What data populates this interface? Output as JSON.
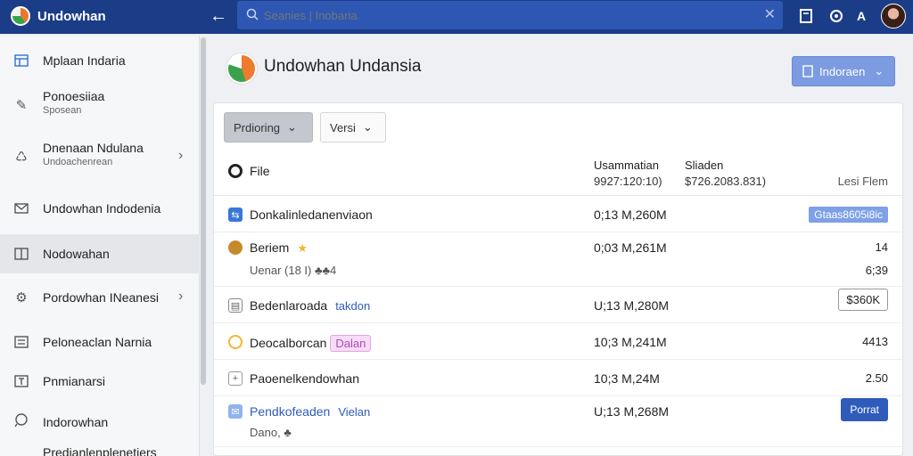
{
  "app": {
    "title": "Undowhan"
  },
  "search": {
    "placeholder": "Seanies | Inobaria"
  },
  "sidebar": {
    "items": [
      {
        "label": "Mplaan Indaria",
        "sub": ""
      },
      {
        "label": "Ponoesiiaa",
        "sub": "Sposean"
      },
      {
        "label": "Dnenaan Ndulana",
        "sub": "Undoachenrean"
      },
      {
        "label": "Undowhan Indodenia",
        "sub": ""
      },
      {
        "label": "Nodowahan",
        "sub": ""
      },
      {
        "label": "Pordowhan INeanesi",
        "sub": ""
      },
      {
        "label": "Peloneaclan Narnia",
        "sub": ""
      },
      {
        "label": "Pnmianarsi",
        "sub": ""
      },
      {
        "label": "Indorowhan",
        "sub": ""
      },
      {
        "label": "Predianlenplenetiers",
        "sub": ""
      }
    ]
  },
  "main": {
    "title": "Undowhan Undansia",
    "lang_button": "Indoraen",
    "filters": [
      "Prdioring",
      "Versi"
    ]
  },
  "table": {
    "col_file": "File",
    "col_size": "Usammatian",
    "col_size_sub": "9927:120:10)",
    "col_status": "Sliaden",
    "col_status_sub": "$726.2083.831)",
    "col_last": "Lesi Flem",
    "rows": [
      {
        "name": "Donkalinledanenviaon",
        "tag": "",
        "sub": "",
        "size": "0;13 M,260M",
        "last": "Gtaas8605i8ic"
      },
      {
        "name": "Beriem",
        "tag": "★",
        "sub": "Uenar (18 I) ♣♣4",
        "size": "0;03 M,261M",
        "last": "14",
        "last2": "6;39"
      },
      {
        "name": "Bedenlaroada",
        "tag": "takdon",
        "sub": "",
        "size": "U;13 M,280M",
        "last": "$360K"
      },
      {
        "name": "Deocalborcan",
        "tag": "Dalan",
        "sub": "",
        "size": "10;3 M,241M",
        "last": "4413"
      },
      {
        "name": "Paoenelkendowhan",
        "tag": "",
        "sub": "",
        "size": "10;3 M,24M",
        "last": "2.50"
      },
      {
        "name": "Pendkofeaden",
        "tag": "Vielan",
        "sub": "Dano, ♣",
        "size": "U;13 M,268M",
        "last": "Porrat"
      }
    ]
  },
  "colors": {
    "topbar": "#1b3d87",
    "accent": "#2f5bbb"
  }
}
